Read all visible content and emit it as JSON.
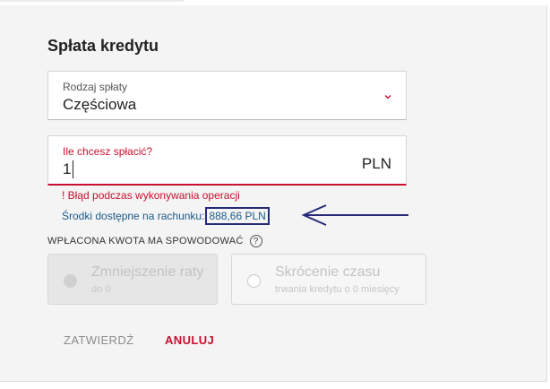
{
  "form": {
    "title": "Spłata kredytu",
    "repayment_type": {
      "label": "Rodzaj spłaty",
      "value": "Częściowa",
      "icon": "chevron-down-icon"
    },
    "amount": {
      "label": "Ile chcesz spłacić?",
      "value": "1",
      "currency": "PLN"
    },
    "error": "! Błąd podczas wykonywania operacji",
    "available_funds": {
      "label": "Środki dostępne na rachunku:",
      "amount": "888,66 PLN"
    },
    "effect_section": {
      "label": "WPŁACONA KWOTA MA SPOWODOWAĆ",
      "help_icon": "?",
      "options": [
        {
          "title": "Zmniejszenie raty",
          "subtitle": "do 0",
          "disabled": true
        },
        {
          "title": "Skrócenie czasu",
          "subtitle": "trwania kredytu o 0 miesięcy",
          "disabled": false
        }
      ]
    },
    "actions": {
      "confirm": "ZATWIERDŹ",
      "cancel": "ANULUJ"
    }
  },
  "colors": {
    "accent": "#c8102e",
    "link": "#1a5a8a",
    "annotation": "#262a78"
  }
}
